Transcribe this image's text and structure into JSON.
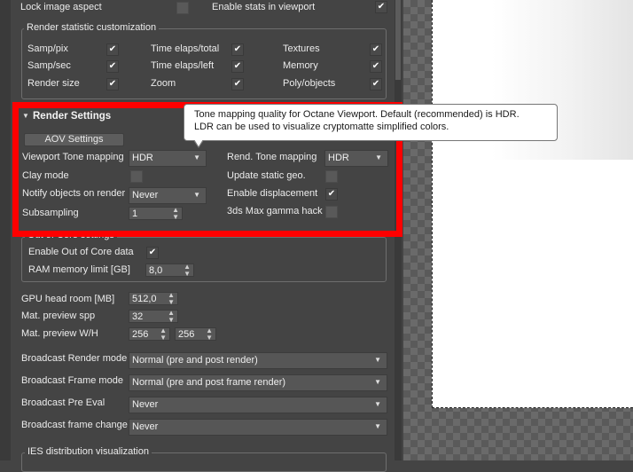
{
  "top": {
    "lock_image_aspect": "Lock image aspect",
    "enable_stats": "Enable stats in viewport"
  },
  "stats_group": {
    "title": "Render statistic customization",
    "items": [
      {
        "label": "Samp/pix",
        "checked": true
      },
      {
        "label": "Time elaps/total",
        "checked": true
      },
      {
        "label": "Textures",
        "checked": true
      },
      {
        "label": "Samp/sec",
        "checked": true
      },
      {
        "label": "Time elaps/left",
        "checked": true
      },
      {
        "label": "Memory",
        "checked": true
      },
      {
        "label": "Render size",
        "checked": true
      },
      {
        "label": "Zoom",
        "checked": true
      },
      {
        "label": "Poly/objects",
        "checked": true
      }
    ]
  },
  "render_settings": {
    "title": "Render Settings",
    "aov_button": "AOV Settings",
    "viewport_tone_label": "Viewport Tone mapping",
    "viewport_tone_value": "HDR",
    "rend_tone_label": "Rend. Tone mapping",
    "rend_tone_value": "HDR",
    "clay_mode_label": "Clay mode",
    "update_static_label": "Update static geo.",
    "notify_label": "Notify objects on render",
    "notify_value": "Never",
    "enable_displacement_label": "Enable displacement",
    "subsampling_label": "Subsampling",
    "subsampling_value": "1",
    "gamma_hack_label": "3ds Max gamma hack"
  },
  "tooltip": {
    "line1": "Tone mapping quality for Octane Viewport. Default (recommended) is HDR.",
    "line2": "LDR can be used to visualize cryptomatte simplified colors."
  },
  "out_of_core": {
    "title": "Out of Core settings",
    "enable_label": "Enable Out of Core data",
    "ram_label": "RAM memory limit [GB]",
    "ram_value": "8,0"
  },
  "gpu": {
    "headroom_label": "GPU head room [MB]",
    "headroom_value": "512,0",
    "mat_spp_label": "Mat. preview spp",
    "mat_spp_value": "32",
    "mat_wh_label": "Mat. preview W/H",
    "mat_w_value": "256",
    "mat_h_value": "256"
  },
  "broadcast": {
    "render_mode_label": "Broadcast Render mode",
    "render_mode_value": "Normal (pre and post render)",
    "frame_mode_label": "Broadcast Frame mode",
    "frame_mode_value": "Normal (pre and post frame render)",
    "pre_eval_label": "Broadcast Pre Eval",
    "pre_eval_value": "Never",
    "frame_change_label": "Broadcast frame change",
    "frame_change_value": "Never"
  },
  "bottom_cut": "IES distribution visualization",
  "icons": {
    "check": "checkmark-icon",
    "dropdown": "chevron-down-icon",
    "spinner": "spinner-arrows-icon",
    "collapse": "triangle-down-icon"
  },
  "colors": {
    "highlight": "#ff0000",
    "panel_bg": "#444444",
    "tooltip_bg": "#ffffff"
  }
}
